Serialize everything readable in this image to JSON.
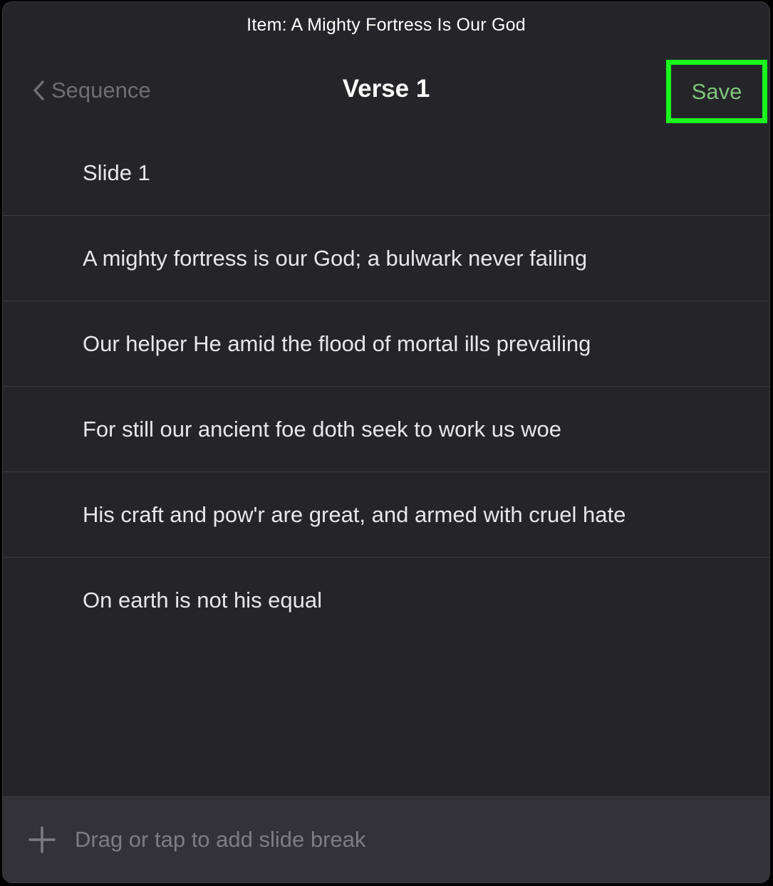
{
  "header": {
    "item_title": "Item: A Mighty Fortress Is Our God"
  },
  "nav": {
    "back_label": "Sequence",
    "title": "Verse 1",
    "save_label": "Save"
  },
  "slides": [
    "Slide 1",
    "A mighty fortress is our God; a bulwark never failing",
    "Our helper He amid the flood of mortal ills prevailing",
    "For still our ancient foe doth seek to work us woe",
    "His craft and pow'r are great, and armed with cruel hate",
    "On earth is not his equal"
  ],
  "footer": {
    "add_break_label": "Drag or tap to add slide break"
  },
  "icons": {
    "back": "chevron-left-icon",
    "add": "plus-icon"
  },
  "colors": {
    "background": "#252529",
    "save_text": "#7fc37b",
    "highlight_box": "#19f71c",
    "secondary_text": "#6e6e73"
  }
}
